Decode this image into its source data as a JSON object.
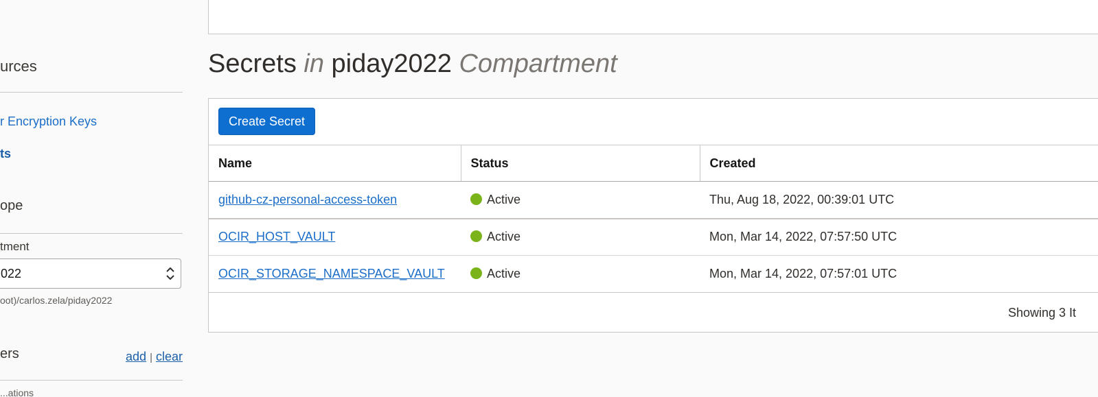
{
  "sidebar": {
    "resources_heading": "urces",
    "nav_items": [
      {
        "label": "r Encryption Keys"
      },
      {
        "label": "ts"
      }
    ],
    "scope_heading": "ope",
    "compartment_label": "tment",
    "compartment_value": "022",
    "compartment_path": "oot)/carlos.zela/piday2022",
    "filters_heading": "ers",
    "add_link": "add",
    "separator": "|",
    "clear_link": "clear",
    "cut_text": "...ations"
  },
  "main": {
    "title_prefix": "Secrets",
    "title_in": "in",
    "title_compartment": "piday2022",
    "title_suffix": "Compartment",
    "create_button": "Create Secret",
    "columns": [
      "Name",
      "Status",
      "Created"
    ],
    "rows": [
      {
        "name": "github-cz-personal-access-token",
        "status": "Active",
        "created": "Thu, Aug 18, 2022, 00:39:01 UTC"
      },
      {
        "name": "OCIR_HOST_VAULT",
        "status": "Active",
        "created": "Mon, Mar 14, 2022, 07:57:50 UTC"
      },
      {
        "name": "OCIR_STORAGE_NAMESPACE_VAULT",
        "status": "Active",
        "created": "Mon, Mar 14, 2022, 07:57:01 UTC"
      }
    ],
    "showing_text": "Showing 3 It"
  },
  "colors": {
    "status_active": "#7bb31a",
    "primary_button": "#0e6fd1",
    "link": "#1b6ec8"
  },
  "icons": {
    "status": "status-dot-icon",
    "select_caret": "updown-caret-icon"
  }
}
